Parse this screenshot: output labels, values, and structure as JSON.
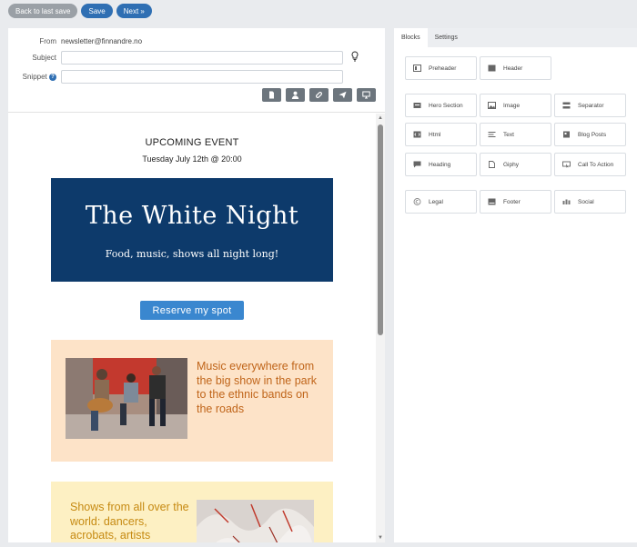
{
  "toolbar": {
    "back_label": "Back to last save",
    "save_label": "Save",
    "next_label": "Next »"
  },
  "form": {
    "from_label": "From",
    "from_value": "newsletter@finnandre.no",
    "subject_label": "Subject",
    "subject_value": "",
    "snippet_label": "Snippet",
    "snippet_value": "",
    "help_glyph": "?"
  },
  "tools": [
    "document-icon",
    "user-icon",
    "attachment-icon",
    "send-icon",
    "desktop-icon"
  ],
  "preview": {
    "event_heading": "UPCOMING EVENT",
    "event_date": "Tuesday July 12th @ 20:00",
    "hero_title": "The White Night",
    "hero_subtitle": "Food, music, shows all night long!",
    "cta_label": "Reserve my spot",
    "card1_text": "Music everywhere from the big show in the park to the ethnic bands on the roads",
    "card2_text": "Shows from all over the world: dancers, acrobats, artists"
  },
  "panel": {
    "tabs": [
      "Blocks",
      "Settings"
    ],
    "active_tab": "Blocks",
    "blocks": [
      {
        "label": "Preheader",
        "icon": "preheader-icon"
      },
      {
        "label": "Header",
        "icon": "header-icon"
      },
      {
        "label": "Hero Section",
        "icon": "hero-icon"
      },
      {
        "label": "Image",
        "icon": "image-icon"
      },
      {
        "label": "Separator",
        "icon": "separator-icon"
      },
      {
        "label": "Html",
        "icon": "html-icon"
      },
      {
        "label": "Text",
        "icon": "text-icon"
      },
      {
        "label": "Blog Posts",
        "icon": "blog-icon"
      },
      {
        "label": "Heading",
        "icon": "heading-icon"
      },
      {
        "label": "Giphy",
        "icon": "giphy-icon"
      },
      {
        "label": "Call To Action",
        "icon": "cta-icon"
      },
      {
        "label": "Legal",
        "icon": "legal-icon"
      },
      {
        "label": "Footer",
        "icon": "footer-icon"
      },
      {
        "label": "Social",
        "icon": "social-icon"
      }
    ]
  },
  "colors": {
    "accent": "#2f6fb3",
    "hero_bg": "#0d3a6b",
    "card1_bg": "#fde3c8",
    "card2_bg": "#fdf0c3"
  }
}
